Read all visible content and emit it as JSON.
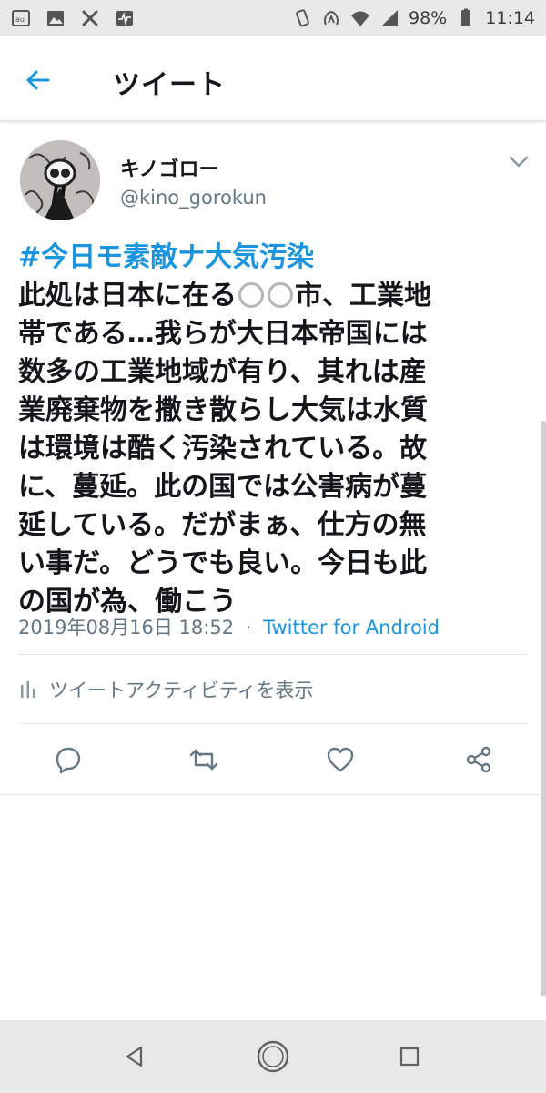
{
  "status_bar": {
    "battery": "98%",
    "time": "11:14",
    "icons": [
      "au-icon",
      "image-icon",
      "tools-icon",
      "activity-icon",
      "vibrate-icon",
      "nfc-icon",
      "wifi-icon",
      "signal-icon",
      "battery-icon"
    ]
  },
  "header": {
    "back_icon": "arrow-left-icon",
    "title": "ツイート"
  },
  "tweet": {
    "display_name": "キノゴロー",
    "handle": "@kino_gorokun",
    "hashtag": "#今日モ素敵ナ大気汚染",
    "lines": [
      {
        "before": "此処は日本に在る",
        "circles": 2,
        "after": "市、工業地"
      },
      {
        "text": "帯である…我らが大日本帝国には"
      },
      {
        "text": "数多の工業地域が有り、其れは産"
      },
      {
        "text": "業廃棄物を撒き散らし大気は水質"
      },
      {
        "text": "は環境は酷く汚染されている。故"
      },
      {
        "text": "に、蔓延。此の国では公害病が蔓"
      },
      {
        "text": "延している。だがまぁ、仕方の無"
      },
      {
        "text": "い事だ。どうでも良い。今日も此"
      },
      {
        "text": "の国が為、働こう"
      }
    ],
    "timestamp": "2019年08月16日 18:52",
    "separator": "·",
    "source": "Twitter for Android",
    "activity_label": "ツイートアクティビティを表示"
  },
  "colors": {
    "accent": "#1b95e0",
    "muted": "#657786",
    "text": "#14171a",
    "divider": "#e1e8ed",
    "system_bar": "#e8e8e8"
  }
}
